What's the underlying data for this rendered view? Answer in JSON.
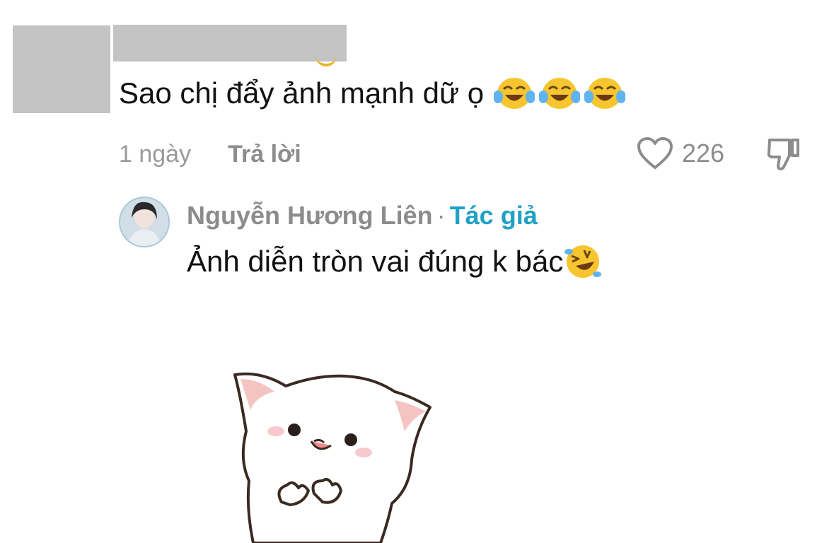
{
  "comment": {
    "text": "Sao chị đẩy ảnh mạnh dữ ọ",
    "emojis": [
      "face-with-tears-of-joy",
      "face-with-tears-of-joy",
      "face-with-tears-of-joy"
    ],
    "time": "1 ngày",
    "reply_label": "Trả lời",
    "like_count": "226"
  },
  "reply": {
    "author": "Nguyễn Hương Liên",
    "separator": "·",
    "badge": "Tác giả",
    "text": "Ảnh diễn tròn vai đúng k bác",
    "emoji": "rolling-on-the-floor-laughing",
    "sticker": "white-cat-sticker"
  },
  "colors": {
    "muted": "#8c8c8c",
    "author_badge": "#1fa1c5",
    "redaction": "#c4c4c4"
  },
  "icons": {
    "like": "heart-outline-icon",
    "dislike": "thumbs-down-outline-icon"
  }
}
